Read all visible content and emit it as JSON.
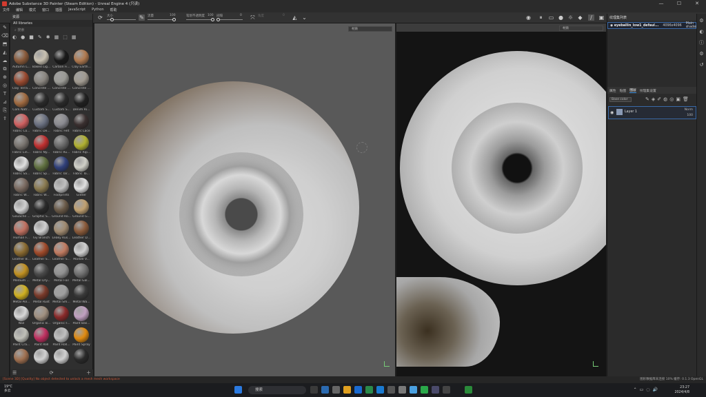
{
  "window": {
    "title": "Adobe Substance 3D Painter (Steam Edition) - Unreal Engine 4 (只读)",
    "min": "—",
    "max": "☐",
    "close": "✕"
  },
  "menu": [
    "文件",
    "编辑",
    "模式",
    "窗口",
    "插图",
    "JavaScript",
    "Python",
    "帮助"
  ],
  "toolbar": {
    "size_label": "大小",
    "size_value": 0.12,
    "flow_label": "流量",
    "flow_value_text": "100",
    "flow_value": 1.0,
    "stroke_label": "笔划不透明度",
    "stroke_value_text": "100",
    "spacing_label": "间隔",
    "spacing_value_text": "0",
    "angle_label": "角度",
    "angle_value_text": "0",
    "toggle_icons": [
      "symmetry-icon",
      "camera-icon",
      "bake-icon",
      "dropper-icon",
      "layout-icon",
      "render-icon",
      "settings-icon"
    ]
  },
  "shelf": {
    "title": "资源",
    "library": "All libraries",
    "search_placeholder": "搜索",
    "items": [
      {
        "label": "Autumn L...",
        "color": "#8a5a3a"
      },
      {
        "label": "Baked Lig...",
        "color": "#c8c0b0"
      },
      {
        "label": "Carbon Fi...",
        "color": "#1a1a1a"
      },
      {
        "label": "Clay Earth...",
        "color": "#b07a50"
      },
      {
        "label": "Clay Terra...",
        "color": "#9a4a30"
      },
      {
        "label": "Concrete ...",
        "color": "#8a8680"
      },
      {
        "label": "Concrete ...",
        "color": "#9a9a95"
      },
      {
        "label": "Concrete ...",
        "color": "#a09a90"
      },
      {
        "label": "Cork Natr...",
        "color": "#a06a40"
      },
      {
        "label": "Custom S...",
        "color": "#2a2a2a"
      },
      {
        "label": "Custom S...",
        "color": "#2a2a2a"
      },
      {
        "label": "Denim Ri...",
        "color": "#202020"
      },
      {
        "label": "Fabric Co...",
        "color": "#d06060"
      },
      {
        "label": "Fabric De...",
        "color": "#6a7080"
      },
      {
        "label": "Fabric Felt",
        "color": "#8a8a90"
      },
      {
        "label": "Fabric Lace",
        "color": "#3a3030"
      },
      {
        "label": "Fabric Lin...",
        "color": "#7a7570"
      },
      {
        "label": "Fabric Ny...",
        "color": "#c03030"
      },
      {
        "label": "Fabric Ru...",
        "color": "#6a6a6a"
      },
      {
        "label": "Fabric Rip...",
        "color": "#b0b030"
      },
      {
        "label": "Fabric Sa...",
        "color": "#e0e0e0"
      },
      {
        "label": "Fabric Sp...",
        "color": "#607040"
      },
      {
        "label": "Fabric Tar...",
        "color": "#30407a"
      },
      {
        "label": "Fabric To...",
        "color": "#d0d0c8"
      },
      {
        "label": "Fabric W...",
        "color": "#7a6a60"
      },
      {
        "label": "Fabric W...",
        "color": "#8a7a50"
      },
      {
        "label": "Footprints",
        "color": "#c0c0c0"
      },
      {
        "label": "Glitter",
        "color": "#e0e0e0"
      },
      {
        "label": "Gouache ...",
        "color": "#d0d0d0"
      },
      {
        "label": "Graphic S...",
        "color": "#2a2a2a"
      },
      {
        "label": "Ground Ro...",
        "color": "#6a5a48"
      },
      {
        "label": "Ground G...",
        "color": "#c0a070"
      },
      {
        "label": "Human F...",
        "color": "#c07060"
      },
      {
        "label": "Ivy Branch",
        "color": "#d0d0d0"
      },
      {
        "label": "Leaky Rus...",
        "color": "#a08a70"
      },
      {
        "label": "Leather D...",
        "color": "#8a5a3a"
      },
      {
        "label": "Leather B...",
        "color": "#8a6a30"
      },
      {
        "label": "Leather S...",
        "color": "#a04a2a"
      },
      {
        "label": "Leather S...",
        "color": "#c07a60"
      },
      {
        "label": "Marble V...",
        "color": "#d0d0d0"
      },
      {
        "label": "Medium ...",
        "color": "#c09020"
      },
      {
        "label": "Metal Dry...",
        "color": "#4a4a4a"
      },
      {
        "label": "Metal Foil",
        "color": "#909090"
      },
      {
        "label": "Metal Gal...",
        "color": "#707070"
      },
      {
        "label": "Metal Pol...",
        "color": "#d0b020"
      },
      {
        "label": "Metal Rust",
        "color": "#7a3a2a"
      },
      {
        "label": "Metal Sm...",
        "color": "#a0a0a0"
      },
      {
        "label": "Metal Wa...",
        "color": "#3a3a3a"
      },
      {
        "label": "Nail",
        "color": "#d8d8d8"
      },
      {
        "label": "Organic B...",
        "color": "#a09080"
      },
      {
        "label": "Organic F...",
        "color": "#8a2a2a"
      },
      {
        "label": "Paint Bas...",
        "color": "#c0a0c0"
      },
      {
        "label": "Paint Cra...",
        "color": "#c0c0b8"
      },
      {
        "label": "Paint Roll",
        "color": "#c03060"
      },
      {
        "label": "Paint Roll...",
        "color": "#c0c0c0"
      },
      {
        "label": "Paint Spray",
        "color": "#e08a10"
      },
      {
        "label": "",
        "color": "#a07050"
      },
      {
        "label": "",
        "color": "#d0d0d0"
      },
      {
        "label": "",
        "color": "#d0d0d0"
      },
      {
        "label": "",
        "color": "#2a2a2a"
      }
    ]
  },
  "viewport3d": {
    "mode": "材质"
  },
  "viewport2d": {
    "mode": "材质"
  },
  "texture_sets": {
    "title": "纹理集列表",
    "name": "eyeballin_low1_defaul...",
    "resolution": "4096x4096",
    "shader": "Main shader"
  },
  "layers": {
    "tabs": [
      "属性",
      "贴图",
      "图层",
      "纹理集设置"
    ],
    "active_tab": "图层",
    "channel": "Base color",
    "layer_name": "Layer 1",
    "blend": "Norm",
    "opacity": "100"
  },
  "status": {
    "error": "[Scene 3D] [Quality] No object detected to unlock a mesh mesh workspace",
    "info": "图形数据库未连接   10%   缓存: 0.1.3   OpenGL"
  },
  "taskbar": {
    "temp": "19°C",
    "weather": "多云",
    "search": "搜索",
    "time": "23:27",
    "date": "2024/4/8"
  }
}
